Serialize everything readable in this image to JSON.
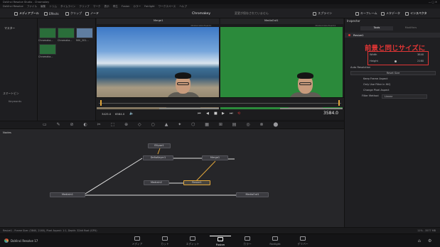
{
  "app": {
    "title": "DaVinci Resolve Studio - Chromakey",
    "menu": [
      "DaVinci Resolve",
      "ファイル",
      "編集",
      "トリム",
      "タイムライン",
      "クリップ",
      "マーク",
      "表示",
      "再生",
      "Fusion",
      "カラー",
      "Fairlight",
      "ワークスペース",
      "ヘルプ"
    ]
  },
  "toolbar": {
    "media_pool": "メディアプール",
    "effects": "Effects",
    "clips": "クリップ",
    "nodes": "ノード",
    "project_title": "Chromakey",
    "project_status": "変更が保存されていません",
    "spline": "スプライン",
    "keyframes": "キーフレーム",
    "metadata": "メタデータ",
    "inspector": "インスペクタ"
  },
  "media_panel": {
    "master_label": "マスター",
    "smart_bins_label": "スマートビン",
    "keywords_label": "Keywords",
    "clips": [
      {
        "label": "Chromaka..."
      },
      {
        "label": "Chromaka..."
      },
      {
        "label": "MVI_201..."
      },
      {
        "label": "Chromaka..."
      }
    ]
  },
  "viewers": {
    "left_node": "Merge1",
    "right_node": "MediaOut1",
    "left_meta": "3840x2160xfloat32",
    "right_meta": "3840x2160xfloat32",
    "timecode_start": "3425.0",
    "timecode_mid": "6584.0",
    "current_frame": "3584.0"
  },
  "inspector": {
    "title": "Inspector",
    "tab_tools": "Tools",
    "tab_modifiers": "Modifiers",
    "node_name": "Resize1",
    "annotation_text": "前景と同じサイズに",
    "width_label": "Width",
    "width_value": "3840",
    "height_label": "Height",
    "height_value": "2160",
    "auto_resolution": "Auto Resolution",
    "reset_size": "Reset Size",
    "keep_aspect": "Keep Frame Aspect",
    "only_hiq": "Only Use Filter in HiQ",
    "change_aspect": "Change Pixel Aspect",
    "filter_label": "Filter Method",
    "filter_value": "Linear"
  },
  "node_editor": {
    "title": "Nodes",
    "nodes": {
      "ellipse": "Ellipse1",
      "delta_keyer": "DeltaKeyer1",
      "merge": "Merge1",
      "media_in1": "MediaIn1",
      "media_in2": "MediaIn2",
      "resize": "Resize1",
      "media_out": "MediaOut1"
    }
  },
  "status": {
    "left": "Resize1 - Frame Size: (3840, 2160), Pixel Aspect: 1:1, Depth: 32bit float (GPU)",
    "right": "11% - 3577 MB"
  },
  "pagebar": {
    "app_label": "DaVinci Resolve 17",
    "pages": [
      "メディア",
      "カット",
      "エディット",
      "Fusion",
      "カラー",
      "Fairlight",
      "デリバー"
    ],
    "active_page": "Fusion"
  },
  "colors": {
    "accent": "#e2a73b",
    "annotation": "#e03535",
    "link_blue": "#4a87b6"
  }
}
